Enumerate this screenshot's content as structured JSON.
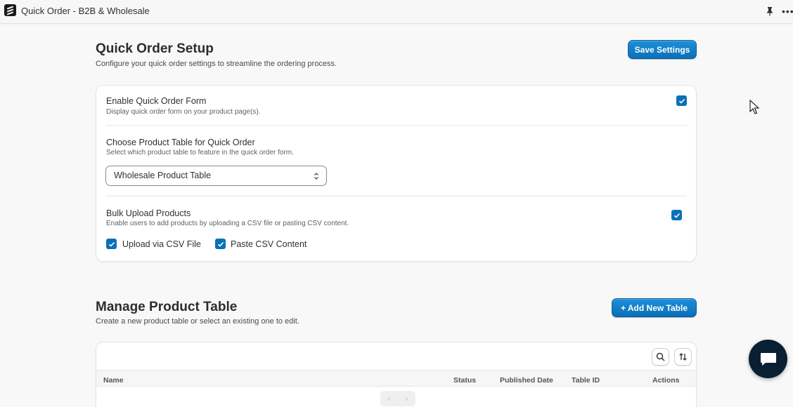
{
  "app": {
    "title": "Quick Order - B2B & Wholesale"
  },
  "setup": {
    "title": "Quick Order Setup",
    "subtitle": "Configure your quick order settings to streamline the ordering process.",
    "save_label": "Save Settings",
    "enable_form": {
      "title": "Enable Quick Order Form",
      "desc": "Display quick order form on your product page(s).",
      "checked": true
    },
    "product_table": {
      "title": "Choose Product Table for Quick Order",
      "desc": "Select which product table to feature in the quick order form.",
      "selected": "Wholesale Product Table"
    },
    "bulk_upload": {
      "title": "Bulk Upload Products",
      "desc": "Enable users to add products by uploading a CSV file or pasting CSV content.",
      "checked": true,
      "options": [
        {
          "label": "Upload via CSV File",
          "checked": true
        },
        {
          "label": "Paste CSV Content",
          "checked": true
        }
      ]
    }
  },
  "manage": {
    "title": "Manage Product Table",
    "subtitle": "Create a new product table or select an existing one to edit.",
    "add_label": "+ Add New Table",
    "columns": [
      "Name",
      "Status",
      "Published Date",
      "Table ID",
      "Actions"
    ],
    "pager": {
      "prev": "‹",
      "next": "›"
    }
  },
  "colors": {
    "accent": "#0a70b8",
    "chat": "#0b1f33"
  },
  "icons": [
    "app-logo-icon",
    "pin-icon",
    "more-icon",
    "checkmark-icon",
    "chevron-updown-icon",
    "search-icon",
    "sort-icon",
    "chat-icon",
    "cursor-icon"
  ]
}
